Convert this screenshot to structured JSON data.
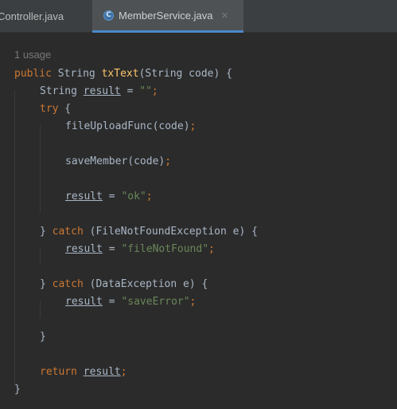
{
  "tabs": [
    {
      "label": "Controller.java",
      "active": false
    },
    {
      "label": "MemberService.java",
      "active": true,
      "icon": "class-icon",
      "icon_letter": "C",
      "close": "×"
    }
  ],
  "editor": {
    "usage_hint": "1 usage",
    "lines": {
      "l1": {
        "kw": "public",
        "type": " String ",
        "fn": "txText",
        "rest": "(String code) {"
      },
      "l2": {
        "a": "String ",
        "var": "result",
        "b": " = ",
        "str": "\"\"",
        "semi": ";"
      },
      "l3": {
        "kw": "try",
        "rest": " {"
      },
      "l4": {
        "text": "fileUploadFunc(code)",
        "semi": ";"
      },
      "l5": {
        "text": "saveMember(code)",
        "semi": ";"
      },
      "l6": {
        "var": "result",
        "b": " = ",
        "str": "\"ok\"",
        "semi": ";"
      },
      "l7": {
        "a": "} ",
        "kw": "catch",
        "rest": " (FileNotFoundException e) {"
      },
      "l8": {
        "var": "result",
        "b": " = ",
        "str": "\"fileNotFound\"",
        "semi": ";"
      },
      "l9": {
        "a": "} ",
        "kw": "catch",
        "rest": " (DataException e) {"
      },
      "l10": {
        "var": "result",
        "b": " = ",
        "str": "\"saveError\"",
        "semi": ";"
      },
      "l11": {
        "text": "}"
      },
      "l12": {
        "kw": "return",
        "sp": " ",
        "var": "result",
        "semi": ";"
      },
      "l13": {
        "text": "}"
      }
    }
  },
  "colors": {
    "background": "#2b2b2b",
    "keyword": "#cc7832",
    "function": "#ffc66d",
    "string": "#6a8759",
    "text": "#a9b7c6",
    "tab_accent": "#4a88c7"
  }
}
